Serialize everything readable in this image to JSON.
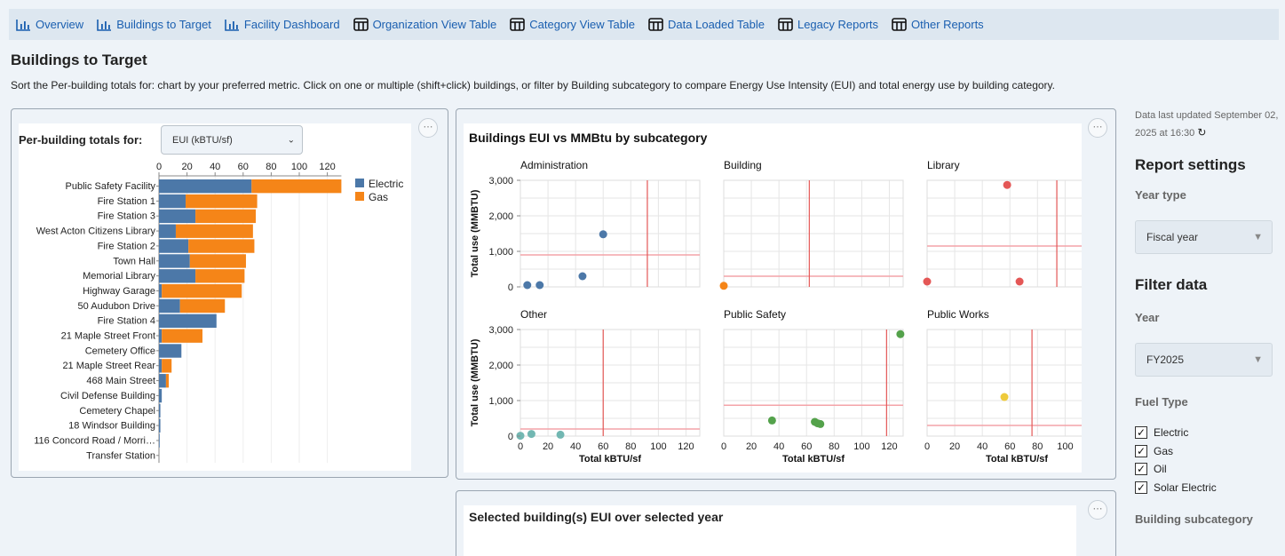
{
  "nav": {
    "items": [
      {
        "label": "Overview",
        "icon": "bar-chart-icon"
      },
      {
        "label": "Buildings to Target",
        "icon": "bar-chart-icon"
      },
      {
        "label": "Facility Dashboard",
        "icon": "bar-chart-icon"
      },
      {
        "label": "Organization View Table",
        "icon": "table-icon"
      },
      {
        "label": "Category View Table",
        "icon": "table-icon"
      },
      {
        "label": "Data Loaded Table",
        "icon": "table-icon"
      },
      {
        "label": "Legacy Reports",
        "icon": "table-icon"
      },
      {
        "label": "Other Reports",
        "icon": "table-icon"
      }
    ]
  },
  "page": {
    "title": "Buildings to Target",
    "description": "Sort the Per-building totals for: chart by your preferred metric. Click on one or multiple (shift+click) buildings, or filter by Building subcategory to compare Energy Use Intensity (EUI) and total energy use by building category."
  },
  "per_building": {
    "control_label": "Per-building totals for:",
    "select_value": "EUI (kBTU/sf)"
  },
  "scatter_panel": {
    "title": "Buildings EUI vs MMBtu by subcategory"
  },
  "eui_panel": {
    "title": "Selected building(s) EUI over selected year"
  },
  "menu_icon": "⋯",
  "sidebar": {
    "updated_text": "Data last updated September 02, 2025 at 16:30",
    "refresh_icon": "↻",
    "report_settings": "Report settings",
    "year_type_label": "Year type",
    "year_type_value": "Fiscal year",
    "filter_data": "Filter data",
    "year_label": "Year",
    "year_value": "FY2025",
    "fuel_type_label": "Fuel Type",
    "fuel_types": [
      "Electric",
      "Gas",
      "Oil",
      "Solar Electric"
    ],
    "subcategory_label": "Building subcategory",
    "check_mark": "✓",
    "dropdown_triangle": "▼",
    "select_chevron": "⌵"
  },
  "colors": {
    "electric": "#4c78a8",
    "gas": "#f58518",
    "reference_line": "#f4a3a8",
    "reference_line_strong": "#e45756",
    "link": "#1a5fb0"
  },
  "chart_data": [
    {
      "type": "bar",
      "stacked": true,
      "orientation": "horizontal",
      "categories": [
        "Public Safety Facility",
        "Fire Station 1",
        "Fire Station 3",
        "West Acton Citizens Library",
        "Fire Station 2",
        "Town Hall",
        "Memorial Library",
        "Highway Garage",
        "50 Audubon Drive",
        "Fire Station 4",
        "21 Maple Street Front",
        "Cemetery Office",
        "21 Maple Street Rear",
        "468 Main Street",
        "Civil Defense Building",
        "Cemetery Chapel",
        "18 Windsor Building",
        "116 Concord Road / Morri…",
        "Transfer Station"
      ],
      "series": [
        {
          "name": "Electric",
          "values": [
            66,
            19,
            26,
            12,
            21,
            22,
            26,
            2,
            15,
            41,
            2,
            16,
            2,
            5,
            2,
            1,
            1,
            0.5,
            0
          ]
        },
        {
          "name": "Gas",
          "values": [
            64,
            51,
            43,
            55,
            47,
            40,
            35,
            57,
            32,
            0,
            29,
            0,
            7,
            2,
            0,
            0,
            0,
            0,
            0
          ]
        }
      ],
      "x_ticks": [
        "0",
        "20",
        "40",
        "60",
        "80",
        "100",
        "120"
      ],
      "xlim": [
        0,
        130
      ],
      "legend_position": "right"
    },
    {
      "type": "scatter",
      "facets": true,
      "x_label": "Total kBTU/sf",
      "y_label": "Total use (MMBTU)",
      "xlim": [
        0,
        130
      ],
      "ylim": [
        0,
        3000
      ],
      "x_ticks": [
        "0",
        "20",
        "40",
        "60",
        "80",
        "100",
        "120"
      ],
      "y_ticks": [
        "0",
        "1,000",
        "2,000",
        "3,000"
      ],
      "panels": [
        {
          "title": "Administration",
          "color": "#4c78a8",
          "h_line": 900,
          "v_line": 92,
          "points": [
            [
              5,
              50
            ],
            [
              14,
              50
            ],
            [
              45,
              300
            ],
            [
              60,
              1480
            ]
          ]
        },
        {
          "title": "Building",
          "color": "#f58518",
          "h_line": 300,
          "v_line": 62,
          "points": [
            [
              0,
              30
            ]
          ]
        },
        {
          "title": "Library",
          "color": "#e45756",
          "h_line": 1150,
          "v_line": 94,
          "points": [
            [
              0,
              150
            ],
            [
              58,
              2870
            ],
            [
              67,
              150
            ]
          ]
        },
        {
          "title": "Other",
          "color": "#72b7b2",
          "h_line": 200,
          "v_line": 60,
          "points": [
            [
              0,
              10
            ],
            [
              8,
              60
            ],
            [
              29,
              40
            ]
          ]
        },
        {
          "title": "Public Safety",
          "color": "#54a24b",
          "h_line": 870,
          "v_line": 118,
          "points": [
            [
              35,
              440
            ],
            [
              66,
              400
            ],
            [
              68,
              360
            ],
            [
              70,
              340
            ],
            [
              128,
              2870
            ]
          ]
        },
        {
          "title": "Public Works",
          "color": "#eeca3b",
          "h_line": 300,
          "v_line": 76,
          "points": [
            [
              56,
              1100
            ]
          ]
        }
      ]
    }
  ]
}
